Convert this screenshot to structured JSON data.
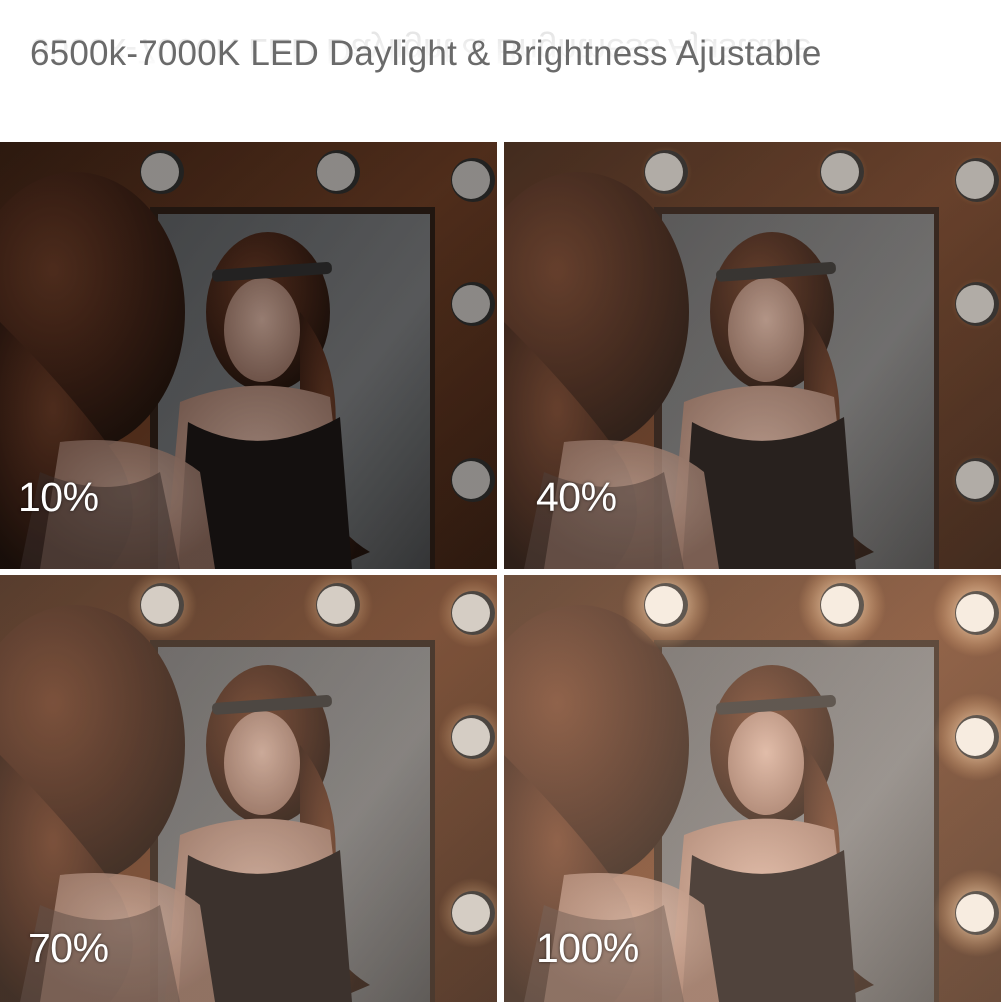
{
  "title": "6500k-7000K LED Daylight & Brightness Ajustable",
  "panels": [
    {
      "label": "10%",
      "brightness": 0.1
    },
    {
      "label": "40%",
      "brightness": 0.4
    },
    {
      "label": "70%",
      "brightness": 0.7
    },
    {
      "label": "100%",
      "brightness": 1.0
    }
  ],
  "colors": {
    "frame_wood": "#6e3c22",
    "frame_dark": "#3a1e10",
    "bulb": "#f4f1ec",
    "text": "#6a6a6a"
  }
}
